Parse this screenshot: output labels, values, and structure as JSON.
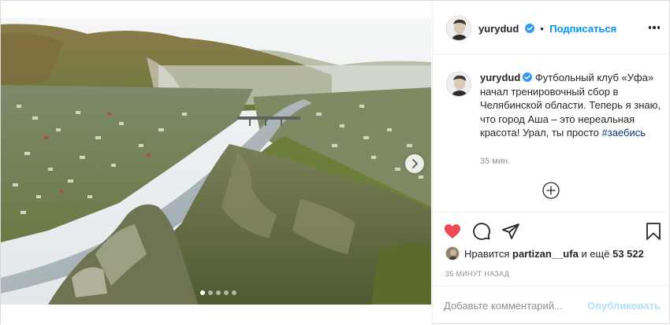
{
  "post": {
    "username": "yurydud",
    "follow_label": "Подписаться",
    "follow_separator": "•",
    "caption_text": "Футбольный клуб «Уфа» начал тренировочный сбор в Челябинской области. Теперь я знаю, что город Аша – это нереальная красота! Урал, ты просто",
    "hashtag": "#заебись",
    "time_ago": "35 мин.",
    "likes": {
      "prefix": "Нравится",
      "user": "partizan__ufa",
      "middle": "и ещё",
      "count": "53 522"
    },
    "posted_ago": "35 МИНУТ НАЗАД",
    "comment_placeholder": "Добавьте комментарий...",
    "publish_label": "Опубликовать"
  },
  "carousel": {
    "slides_total": 5,
    "active_slide": 1
  },
  "icons": {
    "more": "more-dots-icon",
    "verified": "verified-badge-icon",
    "like": "heart-icon",
    "comment": "comment-bubble-icon",
    "share": "paper-plane-icon",
    "save": "bookmark-icon",
    "add_comment": "plus-circle-icon",
    "next": "chevron-right-icon"
  },
  "colors": {
    "link_blue": "#0095f6",
    "heart_red": "#ed4956",
    "publish_disabled": "#b2dffc",
    "hashtag": "#00376b",
    "muted": "#8e8e8e"
  }
}
